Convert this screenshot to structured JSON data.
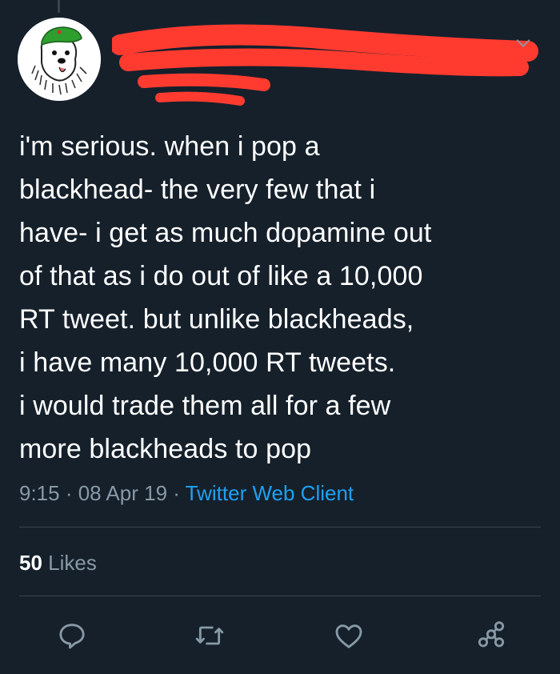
{
  "tweet": {
    "author": {
      "display_name": "",
      "handle": "",
      "avatar": "dog-with-green-beret-icon"
    },
    "text_lines": [
      "i'm serious. when i pop a",
      "blackhead- the very few that i",
      "have- i get as much dopamine out",
      "of that as i do out of like a 10,000",
      "RT tweet. but unlike blackheads,",
      "i have many 10,000 RT tweets.",
      "i would trade them all for a few",
      "more blackheads to pop"
    ],
    "time": "9:15",
    "separator": " · ",
    "date": "08 Apr 19",
    "client": "Twitter Web Client",
    "likes_count": "50",
    "likes_label": "Likes"
  },
  "colors": {
    "background": "#15202b",
    "text": "#ffffff",
    "muted": "#8899a6",
    "accent": "#1da1f2",
    "divider": "#38444d",
    "redaction": "#ff3b30"
  },
  "icons": {
    "more": "chevron-down-icon",
    "reply": "reply-icon",
    "retweet": "retweet-icon",
    "like": "heart-icon",
    "share": "share-icon"
  }
}
